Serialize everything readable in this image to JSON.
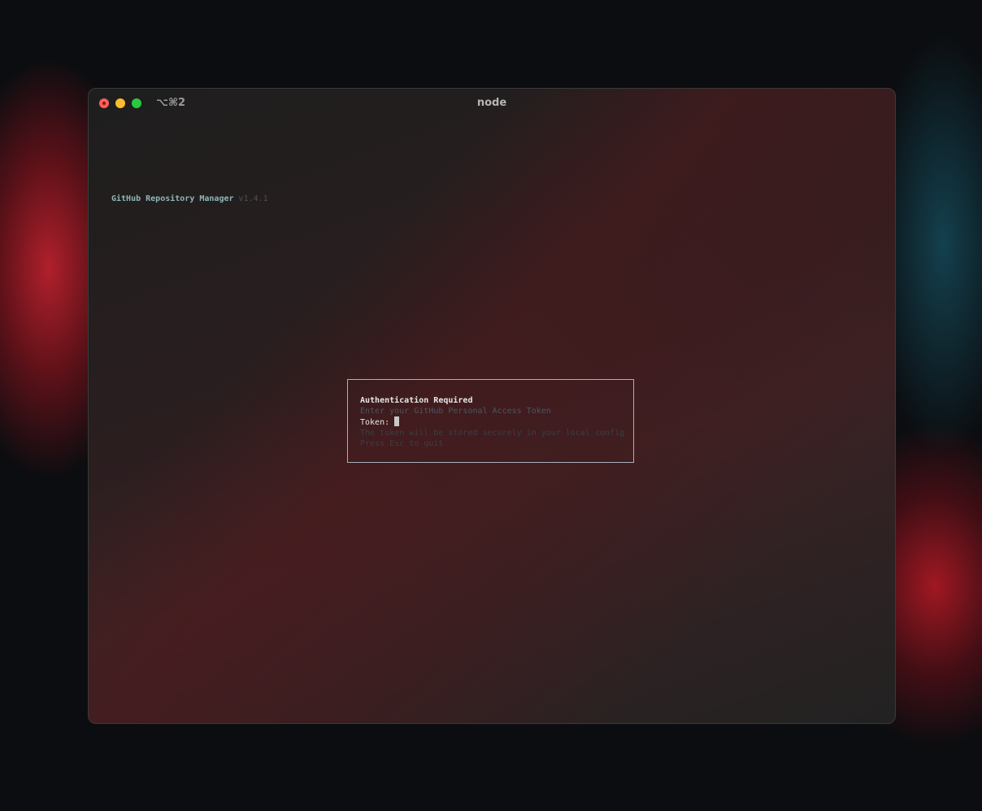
{
  "window": {
    "shortcut": "⌥⌘2",
    "title": "node"
  },
  "header": {
    "app_name": "GitHub Repository Manager",
    "version": "v1.4.1"
  },
  "auth_dialog": {
    "title": "Authentication Required",
    "subtitle": "Enter your GitHub Personal Access Token",
    "token_label": "Token:",
    "token_value": "",
    "note": "The token will be stored securely in your local config",
    "quit_hint": "Press Esc to quit"
  },
  "colors": {
    "close": "#ff5f57",
    "minimize": "#febc2e",
    "maximize": "#28c840",
    "app_name": "#8fb5b5",
    "dialog_border": "#a7b2bc"
  }
}
